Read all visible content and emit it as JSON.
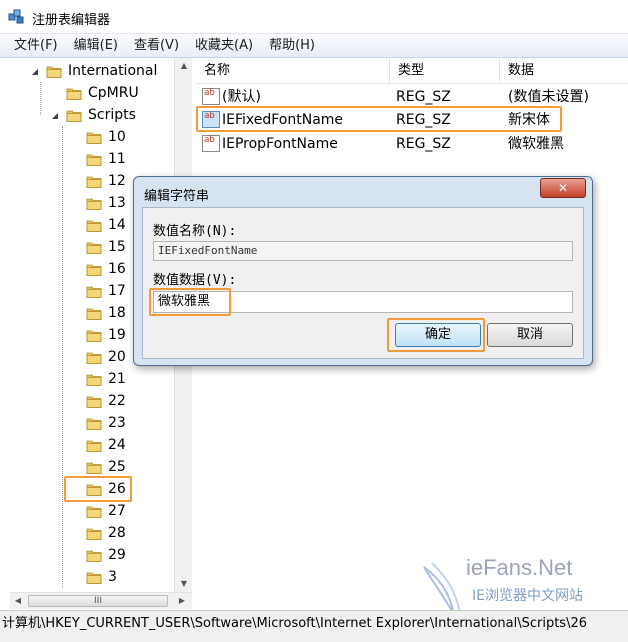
{
  "window": {
    "title": "注册表编辑器"
  },
  "menu": [
    "文件(F)",
    "编辑(E)",
    "查看(V)",
    "收藏夹(A)",
    "帮助(H)"
  ],
  "tree": {
    "items": [
      {
        "label": "International",
        "depth": 0,
        "expanded": true
      },
      {
        "label": "CpMRU",
        "depth": 1
      },
      {
        "label": "Scripts",
        "depth": 1,
        "expanded": true
      },
      {
        "label": "10",
        "depth": 2
      },
      {
        "label": "11",
        "depth": 2
      },
      {
        "label": "12",
        "depth": 2
      },
      {
        "label": "13",
        "depth": 2
      },
      {
        "label": "14",
        "depth": 2
      },
      {
        "label": "15",
        "depth": 2
      },
      {
        "label": "16",
        "depth": 2
      },
      {
        "label": "17",
        "depth": 2
      },
      {
        "label": "18",
        "depth": 2
      },
      {
        "label": "19",
        "depth": 2
      },
      {
        "label": "20",
        "depth": 2
      },
      {
        "label": "21",
        "depth": 2
      },
      {
        "label": "22",
        "depth": 2
      },
      {
        "label": "23",
        "depth": 2
      },
      {
        "label": "24",
        "depth": 2
      },
      {
        "label": "25",
        "depth": 2
      },
      {
        "label": "26",
        "depth": 2,
        "highlighted": true
      },
      {
        "label": "27",
        "depth": 2
      },
      {
        "label": "28",
        "depth": 2
      },
      {
        "label": "29",
        "depth": 2
      },
      {
        "label": "3",
        "depth": 2
      }
    ],
    "hscroll_grip": "III"
  },
  "list": {
    "columns": [
      "名称",
      "类型",
      "数据"
    ],
    "rows": [
      {
        "name": "(默认)",
        "type": "REG_SZ",
        "data": "(数值未设置)"
      },
      {
        "name": "IEFixedFontName",
        "type": "REG_SZ",
        "data": "新宋体",
        "highlighted": true
      },
      {
        "name": "IEPropFontName",
        "type": "REG_SZ",
        "data": "微软雅黑"
      }
    ]
  },
  "dialog": {
    "title": "编辑字符串",
    "close": "✕",
    "name_label": "数值名称(N):",
    "name_value": "IEFixedFontName",
    "data_label": "数值数据(V):",
    "data_value": "微软雅黑",
    "ok": "确定",
    "cancel": "取消"
  },
  "status": {
    "path": "计算机\\HKEY_CURRENT_USER\\Software\\Microsoft\\Internet Explorer\\International\\Scripts\\26"
  },
  "watermark": {
    "main": "ieFans.Net",
    "sub": "IE浏览器中文网站"
  },
  "colors": {
    "highlight_box": "#f39a3a",
    "folder": "#e8c25a",
    "menubar": "#e7edf6",
    "dialog_frame": "#d6e3f1"
  }
}
